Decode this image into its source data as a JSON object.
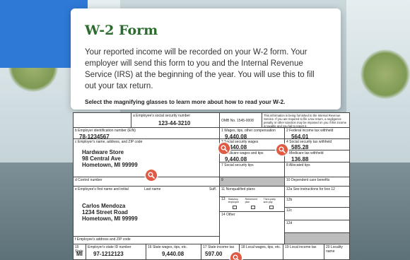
{
  "panel": {
    "title": "W-2 Form",
    "lead": "Your reported income will be recorded on your W-2 form. Your employer will send this form to you and the Internal Revenue Service (IRS) at the beginning of the year. You will use this to fill out your tax return.",
    "hint": "Select the magnifying glasses to learn more about how to read your W-2."
  },
  "form": {
    "box_a_label": "a Employee's social security number",
    "ssn": "123-44-3210",
    "omb": "OMB No. 1545-0008",
    "notice": "This information is being furnished to the Internal Revenue Service. If you are required to file a tax return, a negligence penalty or other sanction may be imposed on you if this income is taxable and you fail to report it.",
    "box_b_label": "b Employer identification number (EIN)",
    "ein": "78-1234567",
    "box1_label": "1 Wages, tips, other compensation",
    "box1": "9,440.08",
    "box2_label": "2 Federal income tax withheld",
    "box2": "564.01",
    "box_c_label": "c Employer's name, address, and ZIP code",
    "employer_name": "Hardware Store",
    "employer_addr1": "98 Central Ave",
    "employer_addr2": "Hometown, MI 99999",
    "box3_label": "3 Social security wages",
    "box3": "9,440.08",
    "box4_label": "4 Social security tax withheld",
    "box4": "585.28",
    "box5_label": "5 Medicare wages and tips",
    "box5": "9,440.08",
    "box6_label": "6 Medicare tax withheld",
    "box6": "136.88",
    "box7_label": "7 Social security tips",
    "box8_label": "8 Allocated tips",
    "box_d_label": "d Control number",
    "box9_label": "9",
    "box10_label": "10 Dependent care benefits",
    "box_e_label": "e Employee's first name and initial",
    "last_name_label": "Last name",
    "suff_label": "Suff.",
    "box11_label": "11 Nonqualified plans",
    "box12a_label": "12a See instructions for box 12",
    "box12b_label": "12b",
    "box12c_label": "12c",
    "box12d_label": "12d",
    "box13_label": "13",
    "statutory_label": "Statutory employee",
    "retirement_label": "Retirement plan",
    "thirdparty_label": "Third-party sick pay",
    "box14_label": "14 Other",
    "employee_name": "Carlos Mendoza",
    "employee_addr1": "1234 Street Road",
    "employee_addr2": "Hometown, MI 99999",
    "box_f_label": "f Employee's address and ZIP code",
    "box15_label": "15 State",
    "state_id_label": "Employer's state ID number",
    "state": "MI",
    "state_id": "97-1212123",
    "box16_label": "16 State wages, tips, etc.",
    "box16": "9,440.08",
    "box17_label": "17 State income tax",
    "box17": "597.00",
    "box18_label": "18 Local wages, tips, etc.",
    "box19_label": "19 Local income tax",
    "box20_label": "20 Locality name"
  },
  "colors": {
    "title_green": "#2c6b2e",
    "magnifier": "#e05a44",
    "accent_blue": "#2e79d6"
  },
  "icons": {
    "magnifier": "magnifying-glass-icon"
  }
}
